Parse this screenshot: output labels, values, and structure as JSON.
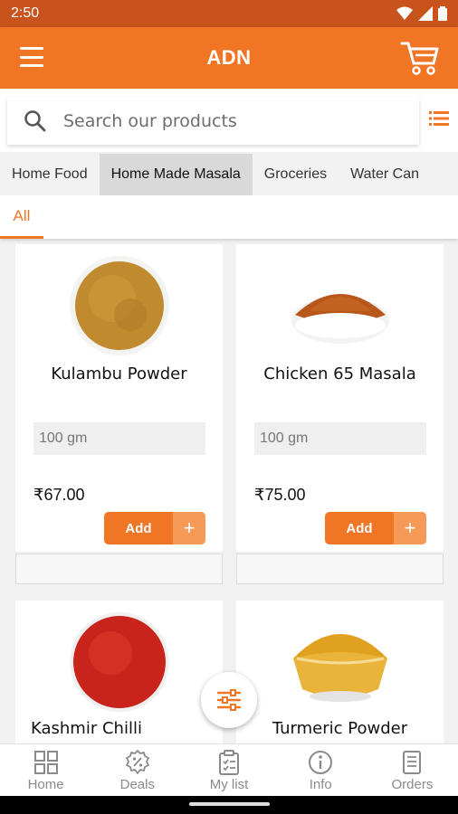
{
  "status": {
    "time": "2:50"
  },
  "app": {
    "title": "ADN",
    "accent": "#f07525"
  },
  "search": {
    "placeholder": "Search our products"
  },
  "categories": [
    "Home Food",
    "Home Made Masala",
    "Groceries",
    "Water Can"
  ],
  "active_category": "Home Made Masala",
  "subcategory": "All",
  "products": [
    {
      "name": "Kulambu Powder",
      "unit": "100 gm",
      "price": "₹67.00",
      "add_label": "Add",
      "add_plus": "+"
    },
    {
      "name": "Chicken 65 Masala",
      "unit": "100 gm",
      "price": "₹75.00",
      "add_label": "Add",
      "add_plus": "+"
    },
    {
      "name": "Kashmir Chilli"
    },
    {
      "name": "Turmeric Powder"
    }
  ],
  "nav": [
    {
      "label": "Home",
      "icon": "grid-icon"
    },
    {
      "label": "Deals",
      "icon": "discount-badge-icon"
    },
    {
      "label": "My list",
      "icon": "shopping-list-icon"
    },
    {
      "label": "Info",
      "icon": "info-icon"
    },
    {
      "label": "Orders",
      "icon": "orders-icon"
    }
  ]
}
